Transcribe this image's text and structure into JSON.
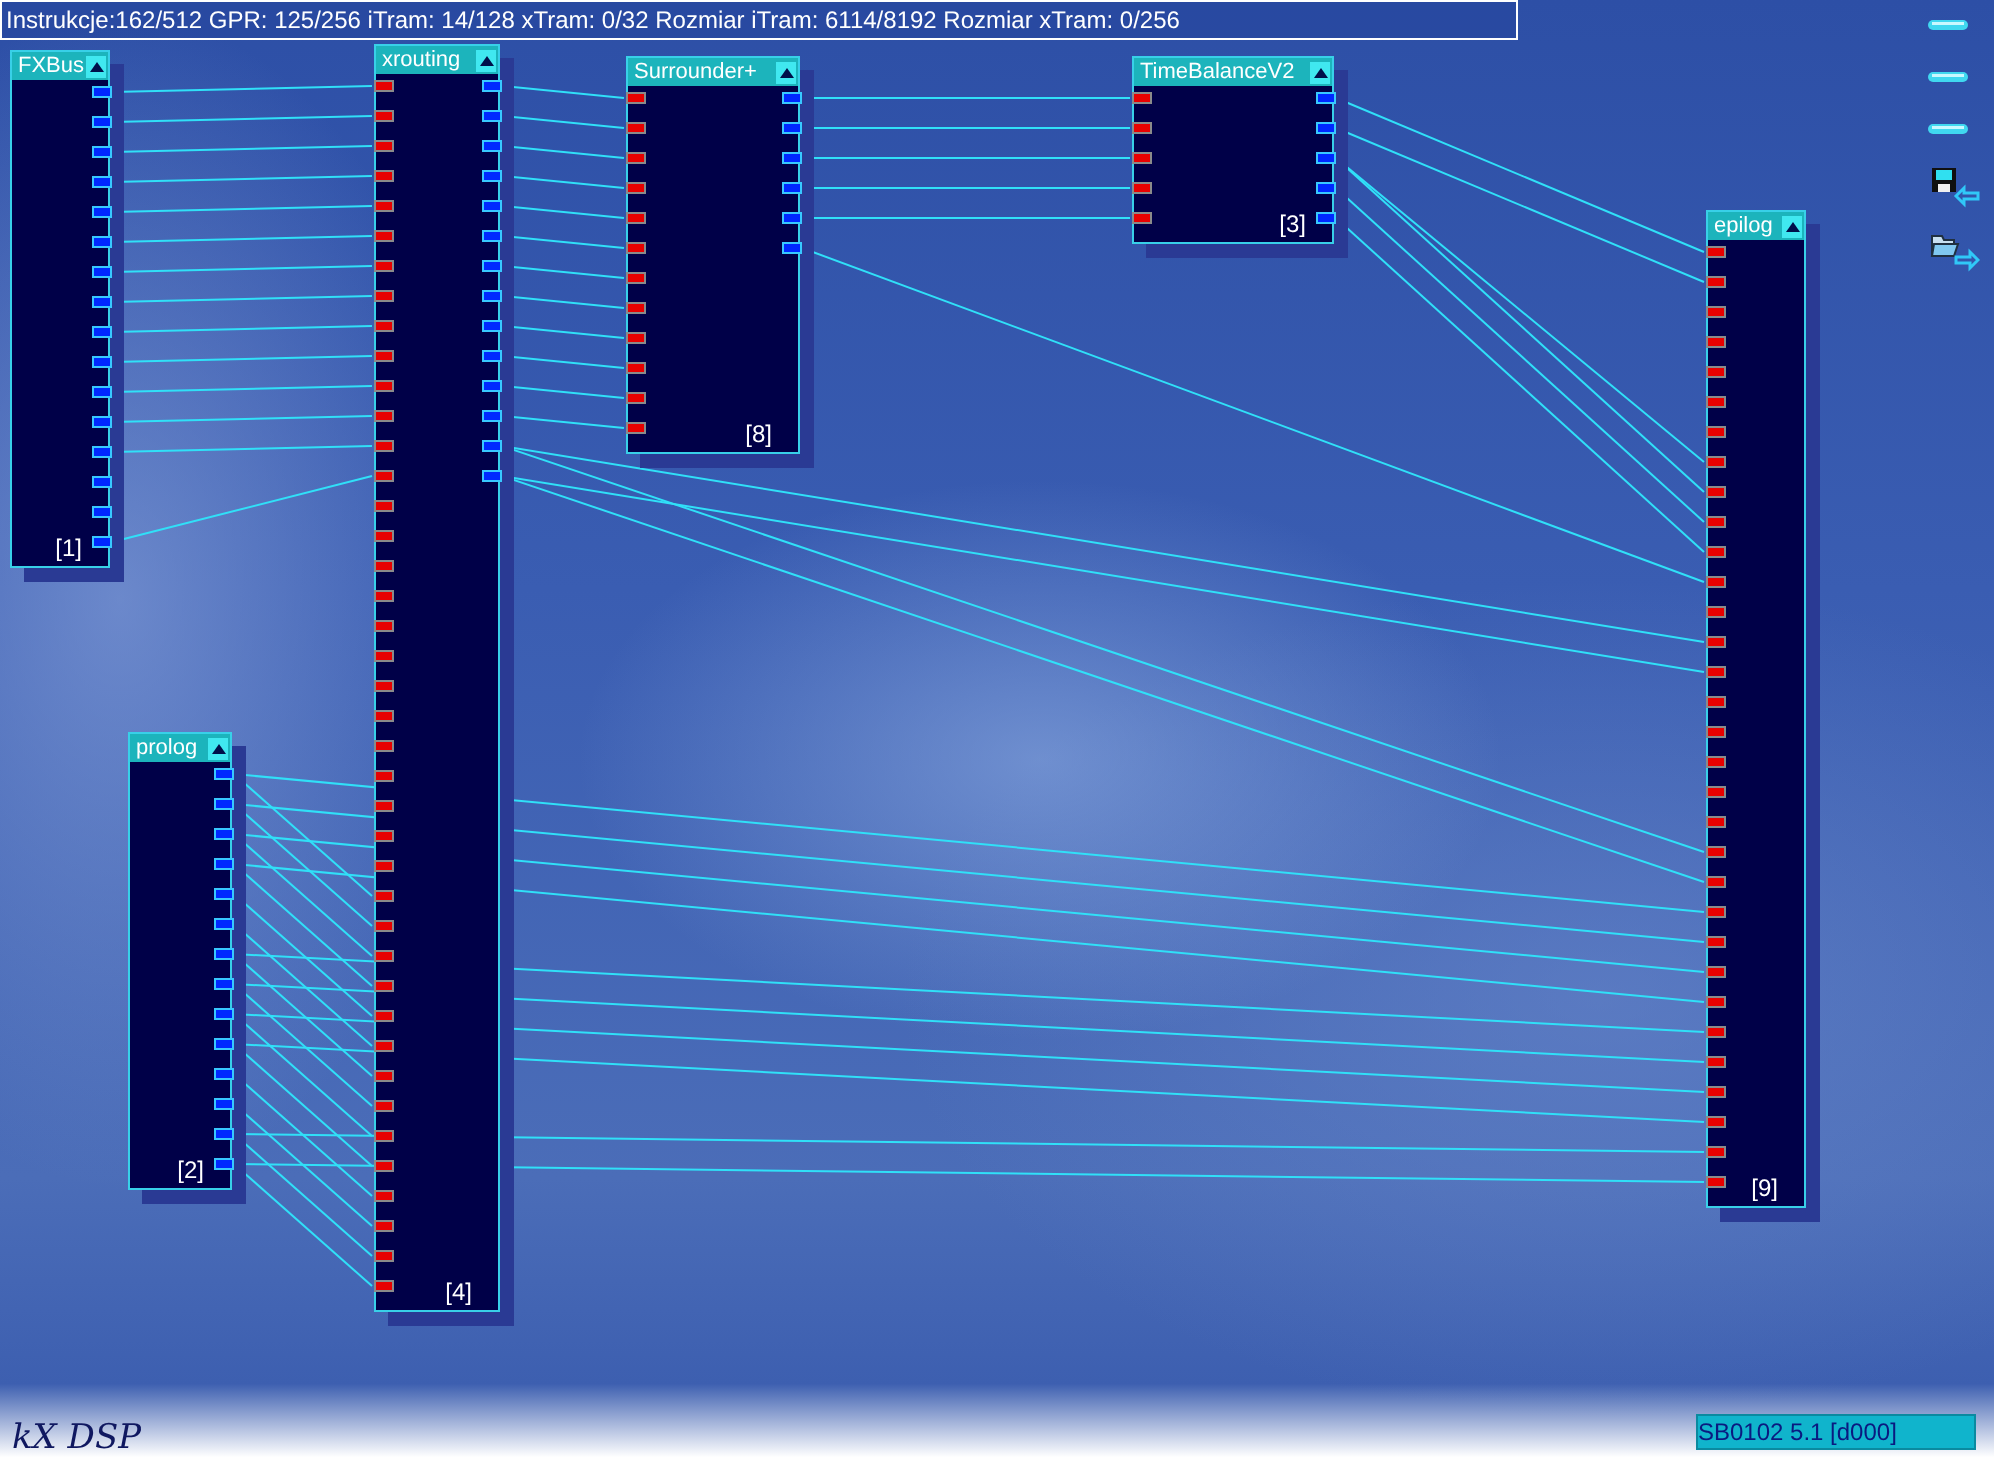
{
  "info_bar": "Instrukcje:162/512 GPR: 125/256 iTram: 14/128 xTram: 0/32 Rozmiar iTram: 6114/8192 Rozmiar xTram: 0/256",
  "plugins": [
    {
      "title": "FXBus",
      "number": "[1]",
      "pins": [
        {
          "kind": "output"
        },
        {
          "kind": "output"
        },
        {
          "kind": "output"
        },
        {
          "kind": "output"
        },
        {
          "kind": "output"
        },
        {
          "kind": "output"
        },
        {
          "kind": "output"
        },
        {
          "kind": "output"
        },
        {
          "kind": "output"
        },
        {
          "kind": "output"
        },
        {
          "kind": "output"
        },
        {
          "kind": "output"
        },
        {
          "kind": "output"
        },
        {
          "kind": "output"
        },
        {
          "kind": "output"
        },
        {
          "kind": "output"
        }
      ]
    },
    {
      "title": "xrouting",
      "number": "[4]",
      "pins": [
        {
          "kind": "input"
        },
        {
          "kind": "input"
        },
        {
          "kind": "input"
        },
        {
          "kind": "input"
        },
        {
          "kind": "input"
        },
        {
          "kind": "input"
        },
        {
          "kind": "input"
        },
        {
          "kind": "input"
        },
        {
          "kind": "input"
        },
        {
          "kind": "input"
        },
        {
          "kind": "input"
        },
        {
          "kind": "input"
        },
        {
          "kind": "input"
        },
        {
          "kind": "input"
        },
        {
          "kind": "input"
        },
        {
          "kind": "input"
        },
        {
          "kind": "input"
        },
        {
          "kind": "input"
        },
        {
          "kind": "input"
        },
        {
          "kind": "input"
        },
        {
          "kind": "input"
        },
        {
          "kind": "input"
        },
        {
          "kind": "input"
        },
        {
          "kind": "input"
        },
        {
          "kind": "input"
        },
        {
          "kind": "input"
        },
        {
          "kind": "input"
        },
        {
          "kind": "input"
        },
        {
          "kind": "input"
        },
        {
          "kind": "input"
        },
        {
          "kind": "input"
        },
        {
          "kind": "input"
        },
        {
          "kind": "input"
        },
        {
          "kind": "input"
        },
        {
          "kind": "input"
        },
        {
          "kind": "input"
        },
        {
          "kind": "input"
        },
        {
          "kind": "input"
        },
        {
          "kind": "input"
        },
        {
          "kind": "input"
        },
        {
          "kind": "input"
        },
        {
          "kind": "output"
        },
        {
          "kind": "output"
        },
        {
          "kind": "output"
        },
        {
          "kind": "output"
        },
        {
          "kind": "output"
        },
        {
          "kind": "output"
        },
        {
          "kind": "output"
        },
        {
          "kind": "output"
        },
        {
          "kind": "output"
        },
        {
          "kind": "output"
        },
        {
          "kind": "output"
        },
        {
          "kind": "output"
        },
        {
          "kind": "output"
        },
        {
          "kind": "output"
        }
      ]
    },
    {
      "title": "Surrounder+",
      "number": "[8]",
      "pins": [
        {
          "kind": "input"
        },
        {
          "kind": "input"
        },
        {
          "kind": "input"
        },
        {
          "kind": "input"
        },
        {
          "kind": "input"
        },
        {
          "kind": "input"
        },
        {
          "kind": "input"
        },
        {
          "kind": "input"
        },
        {
          "kind": "input"
        },
        {
          "kind": "input"
        },
        {
          "kind": "input"
        },
        {
          "kind": "input"
        },
        {
          "kind": "output"
        },
        {
          "kind": "output"
        },
        {
          "kind": "output"
        },
        {
          "kind": "output"
        },
        {
          "kind": "output"
        },
        {
          "kind": "output"
        }
      ]
    },
    {
      "title": "TimeBalanceV2",
      "number": "[3]",
      "pins": [
        {
          "kind": "input"
        },
        {
          "kind": "input"
        },
        {
          "kind": "input"
        },
        {
          "kind": "input"
        },
        {
          "kind": "input"
        },
        {
          "kind": "output"
        },
        {
          "kind": "output"
        },
        {
          "kind": "output"
        },
        {
          "kind": "output"
        },
        {
          "kind": "output"
        }
      ]
    },
    {
      "title": "epilog",
      "number": "[9]",
      "pins": [
        {
          "kind": "input"
        },
        {
          "kind": "input"
        },
        {
          "kind": "input"
        },
        {
          "kind": "input"
        },
        {
          "kind": "input"
        },
        {
          "kind": "input"
        },
        {
          "kind": "input"
        },
        {
          "kind": "input"
        },
        {
          "kind": "input"
        },
        {
          "kind": "input"
        },
        {
          "kind": "input"
        },
        {
          "kind": "input"
        },
        {
          "kind": "input"
        },
        {
          "kind": "input"
        },
        {
          "kind": "input"
        },
        {
          "kind": "input"
        },
        {
          "kind": "input"
        },
        {
          "kind": "input"
        },
        {
          "kind": "input"
        },
        {
          "kind": "input"
        },
        {
          "kind": "input"
        },
        {
          "kind": "input"
        },
        {
          "kind": "input"
        },
        {
          "kind": "input"
        },
        {
          "kind": "input"
        },
        {
          "kind": "input"
        },
        {
          "kind": "input"
        },
        {
          "kind": "input"
        },
        {
          "kind": "input"
        },
        {
          "kind": "input"
        },
        {
          "kind": "input"
        },
        {
          "kind": "input"
        }
      ]
    },
    {
      "title": "prolog",
      "number": "[2]",
      "pins": [
        {
          "kind": "output"
        },
        {
          "kind": "output"
        },
        {
          "kind": "output"
        },
        {
          "kind": "output"
        },
        {
          "kind": "output"
        },
        {
          "kind": "output"
        },
        {
          "kind": "output"
        },
        {
          "kind": "output"
        },
        {
          "kind": "output"
        },
        {
          "kind": "output"
        },
        {
          "kind": "output"
        },
        {
          "kind": "output"
        },
        {
          "kind": "output"
        },
        {
          "kind": "output"
        }
      ]
    }
  ],
  "logo": "kX DSP",
  "device_label": "SB0102 5.1 [d000]"
}
